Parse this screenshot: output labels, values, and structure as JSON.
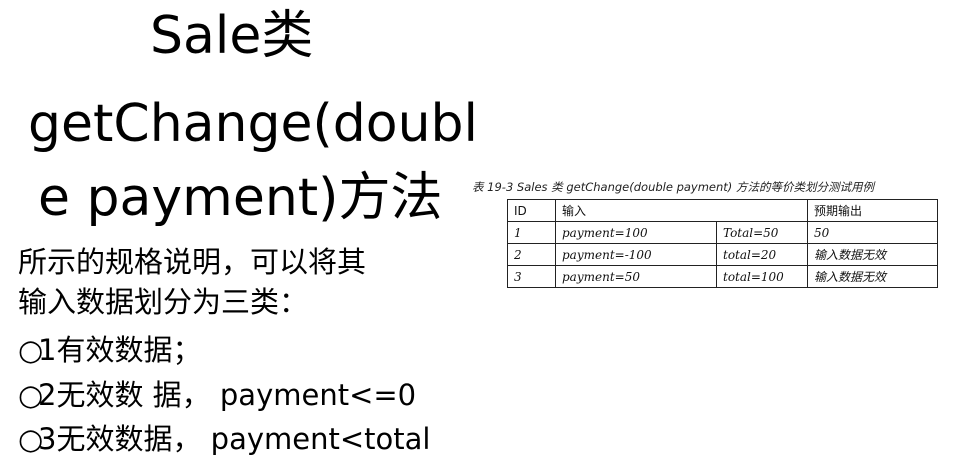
{
  "title": {
    "line1": "Sale类",
    "line2": "getChange(doubl",
    "line3": "e payment)方法"
  },
  "body": {
    "line1": "所示的规格说明，可以将其",
    "line2": "输入数据划分为三类：",
    "bullets": [
      {
        "marker": "○",
        "text": "1有效数据；"
      },
      {
        "marker": "○",
        "text": "2无效数 据，  payment<=0"
      },
      {
        "marker": "○",
        "text": "3无效数据，  payment<total"
      }
    ]
  },
  "table": {
    "caption": "表 19-3 Sales 类 getChange(double payment) 方法的等价类划分测试用例",
    "headers": {
      "id": "ID",
      "input": "输入",
      "expected": "预期输出"
    },
    "rows": [
      {
        "id": "1",
        "in1": "payment=100",
        "in2": "Total=50",
        "out": "50"
      },
      {
        "id": "2",
        "in1": "payment=-100",
        "in2": "total=20",
        "out": "输入数据无效"
      },
      {
        "id": "3",
        "in1": "payment=50",
        "in2": "total=100",
        "out": "输入数据无效"
      }
    ]
  }
}
